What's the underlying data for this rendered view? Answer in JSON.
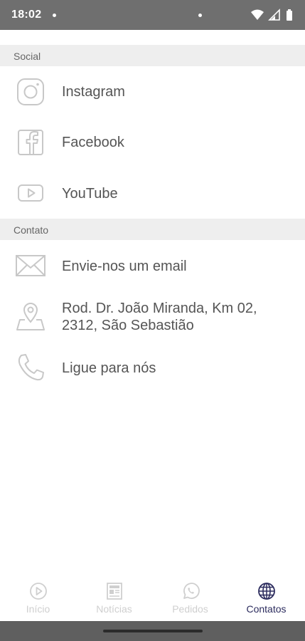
{
  "status_bar": {
    "time": "18:02"
  },
  "sections": {
    "social": {
      "title": "Social",
      "items": [
        {
          "label": "Instagram",
          "icon": "instagram-icon"
        },
        {
          "label": "Facebook",
          "icon": "facebook-icon"
        },
        {
          "label": "YouTube",
          "icon": "youtube-icon"
        }
      ]
    },
    "contato": {
      "title": "Contato",
      "items": [
        {
          "label": "Envie-nos um email",
          "icon": "email-icon"
        },
        {
          "label_line1": "Rod. Dr. João Miranda, Km 02,",
          "label_line2": "2312, São Sebastião",
          "icon": "map-pin-icon"
        },
        {
          "label": "Ligue para nós",
          "icon": "phone-icon"
        }
      ]
    }
  },
  "bottom_nav": {
    "items": [
      {
        "label": "Início",
        "icon": "play-circle-icon",
        "active": false
      },
      {
        "label": "Notícias",
        "icon": "newspaper-icon",
        "active": false
      },
      {
        "label": "Pedidos",
        "icon": "whatsapp-icon",
        "active": false
      },
      {
        "label": "Contatos",
        "icon": "globe-icon",
        "active": true
      }
    ]
  },
  "colors": {
    "status_bar": "#6f6f6f",
    "section_header_bg": "#eeeeee",
    "text": "#555555",
    "icon_stroke": "#c8c8c8",
    "nav_active": "#2c2c5e",
    "nav_inactive": "#cfcfcf"
  }
}
